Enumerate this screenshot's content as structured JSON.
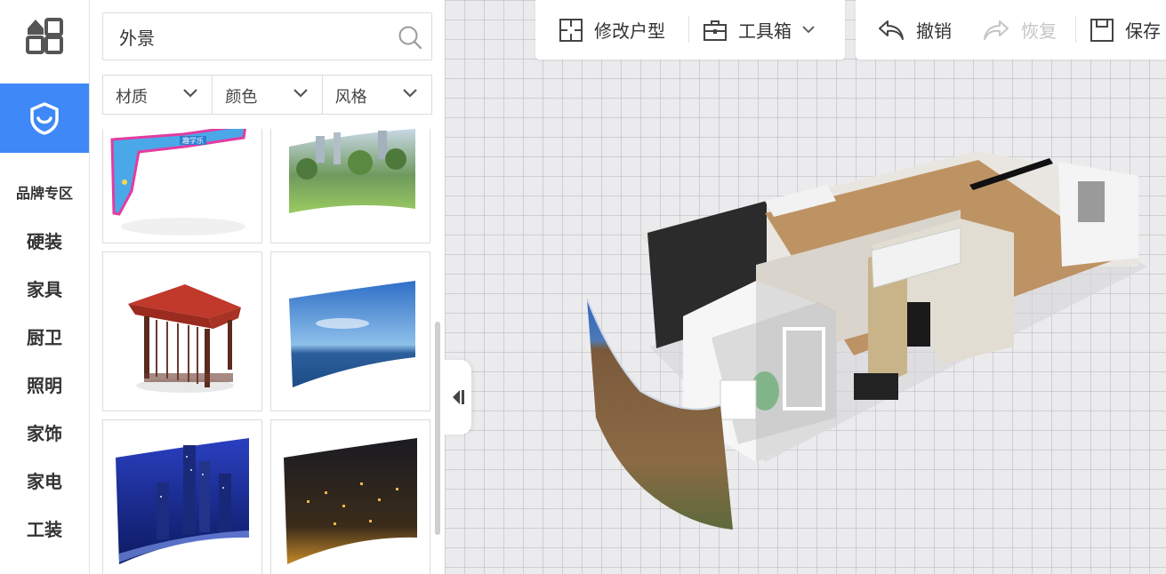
{
  "nav": {
    "brand_zone": "品牌专区",
    "categories": [
      "硬装",
      "家具",
      "厨卫",
      "照明",
      "家饰",
      "家电",
      "工装"
    ]
  },
  "search": {
    "value": "外景"
  },
  "filters": [
    "材质",
    "颜色",
    "风格"
  ],
  "library": {
    "items": [
      {
        "name": "kids-storefront-sign",
        "label": "趣学乐"
      },
      {
        "name": "park-panorama-backdrop"
      },
      {
        "name": "red-tile-pavilion"
      },
      {
        "name": "sea-sky-backdrop"
      },
      {
        "name": "city-night-blue-backdrop"
      },
      {
        "name": "city-night-gold-backdrop"
      }
    ]
  },
  "toolbar": {
    "edit_floorplan": "修改户型",
    "toolbox": "工具箱",
    "undo": "撤销",
    "redo": "恢复",
    "save": "保存"
  },
  "colors": {
    "accent": "#3e88f7",
    "text": "#333333",
    "disabled": "#c4c4c4"
  }
}
